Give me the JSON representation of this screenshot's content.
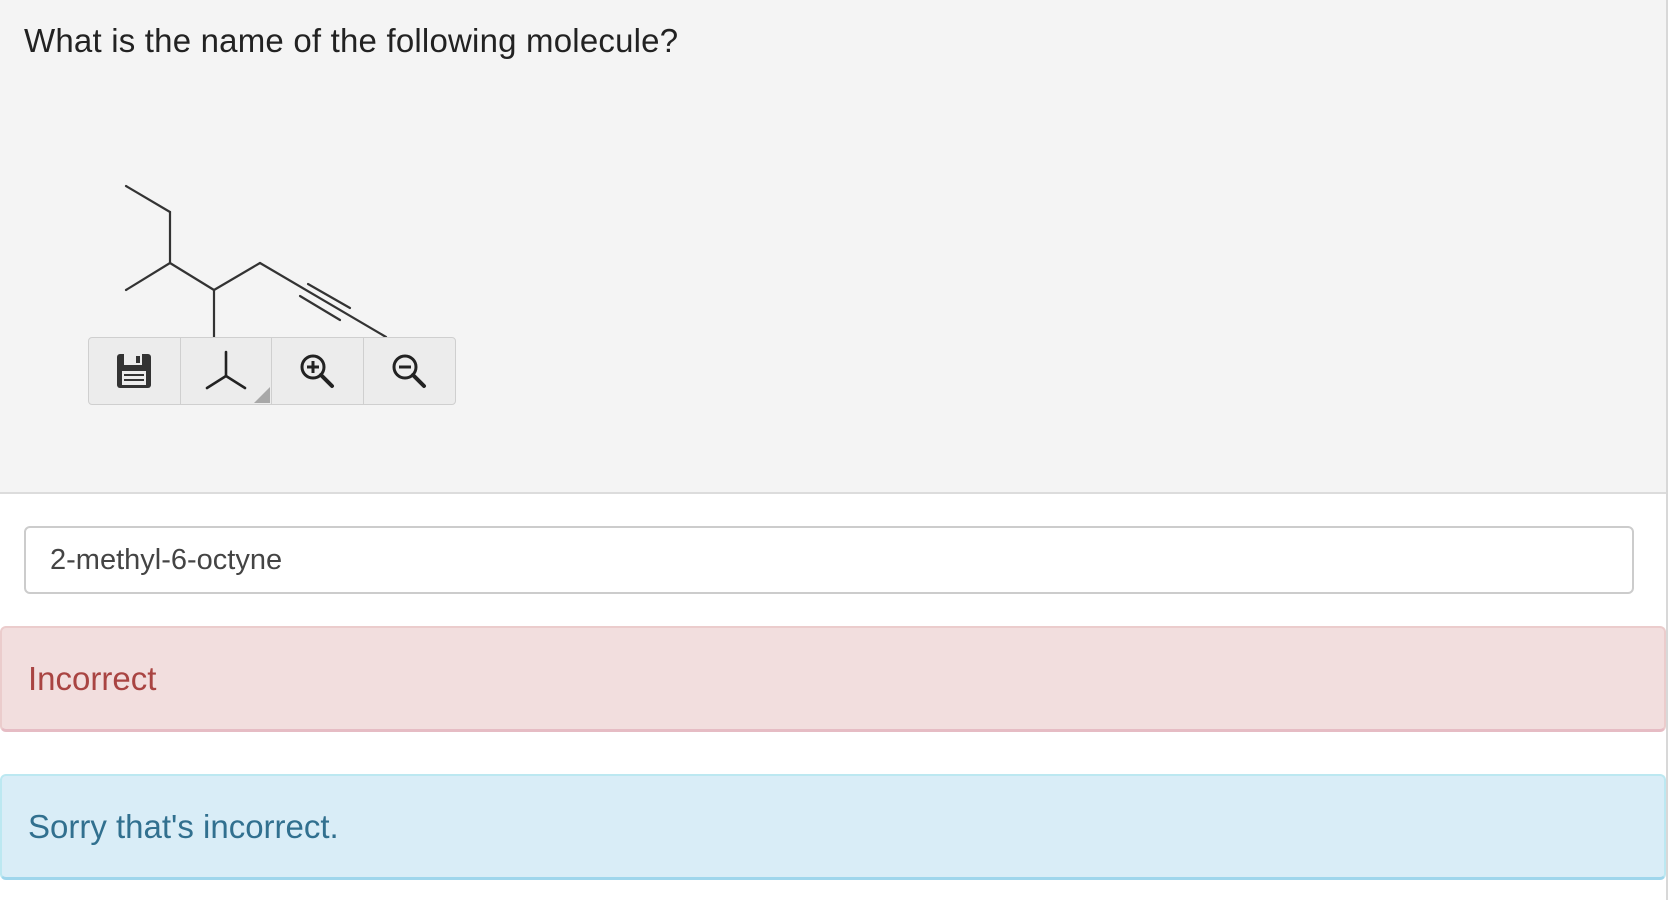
{
  "question": {
    "text": "What is the name of the following molecule?"
  },
  "molecule_toolbar": {
    "buttons": [
      {
        "icon": "save-icon"
      },
      {
        "icon": "structure-menu-icon"
      },
      {
        "icon": "zoom-in-icon"
      },
      {
        "icon": "zoom-out-icon"
      }
    ]
  },
  "answer": {
    "value": "2-methyl-6-octyne"
  },
  "feedback": {
    "status": "Incorrect",
    "message": "Sorry that's incorrect."
  },
  "colors": {
    "panel_bg": "#f4f4f4",
    "danger_bg": "#f2dede",
    "danger_text": "#a94442",
    "info_bg": "#d9edf7",
    "info_text": "#31708f"
  }
}
